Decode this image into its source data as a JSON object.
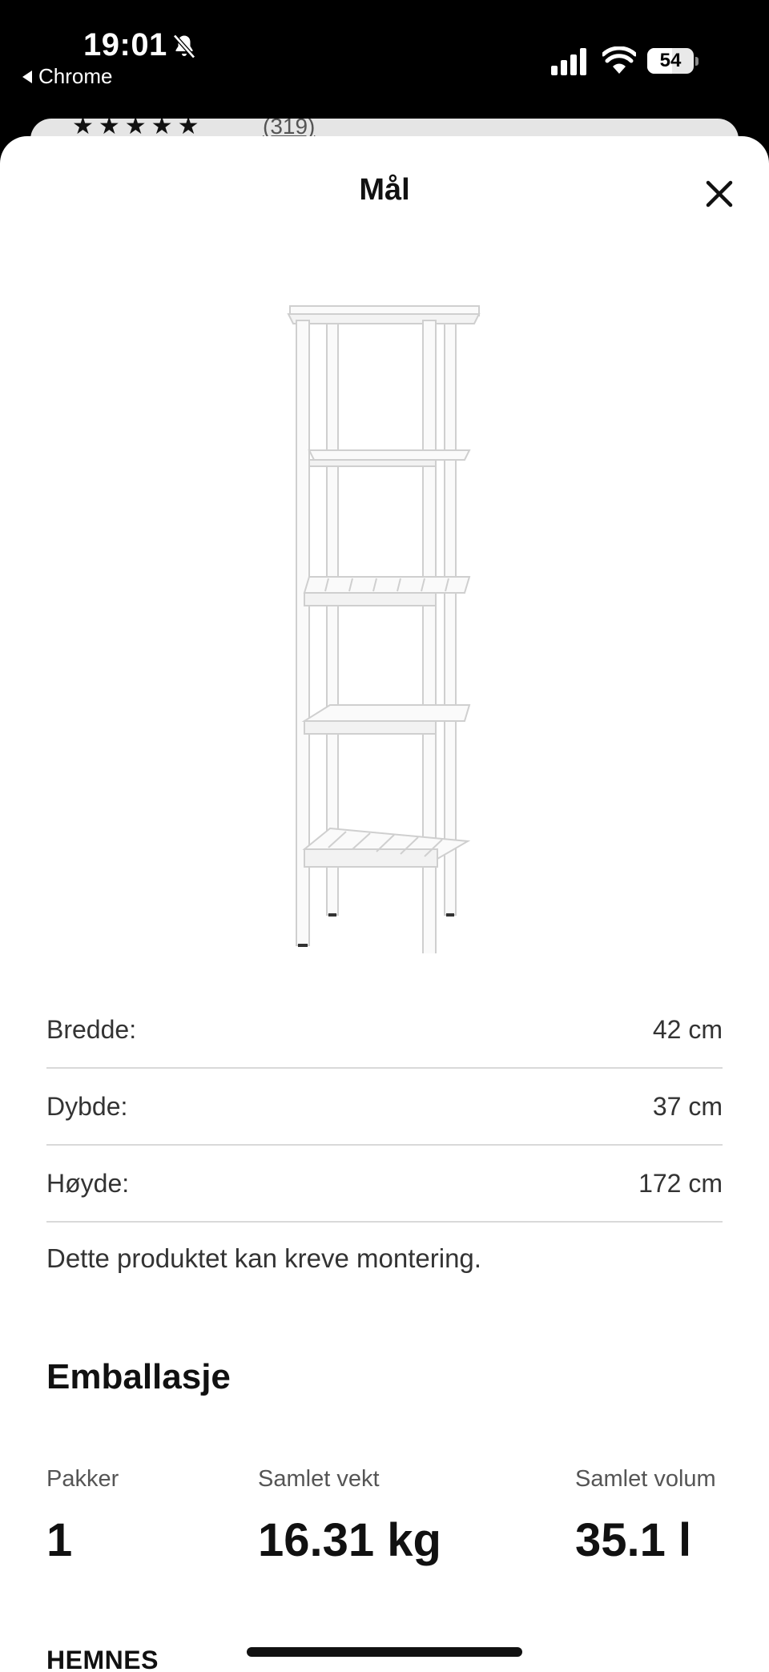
{
  "status_bar": {
    "time": "19:01",
    "back_app": "Chrome",
    "battery_percent": "54",
    "battery_level": 0.54
  },
  "background_page": {
    "rating_stars": 5,
    "review_count": "(319)"
  },
  "modal": {
    "title": "Mål",
    "close_icon": "close-icon"
  },
  "product_image": {
    "alt": "HEMNES hylleenhet, hvit"
  },
  "dimensions": [
    {
      "label": "Bredde:",
      "value": "42 cm"
    },
    {
      "label": "Dybde:",
      "value": "37 cm"
    },
    {
      "label": "Høyde:",
      "value": "172 cm"
    }
  ],
  "assembly_note": "Dette produktet kan kreve montering.",
  "packaging": {
    "title": "Emballasje",
    "stats": [
      {
        "label": "Pakker",
        "value": "1"
      },
      {
        "label": "Samlet vekt",
        "value": "16.31 kg"
      },
      {
        "label": "Samlet volum",
        "value": "35.1 l"
      }
    ]
  },
  "next_section_title": "HEMNES",
  "colors": {
    "background": "#ffffff",
    "text": "#111111",
    "muted": "#555555",
    "divider": "#d9d9d9"
  }
}
